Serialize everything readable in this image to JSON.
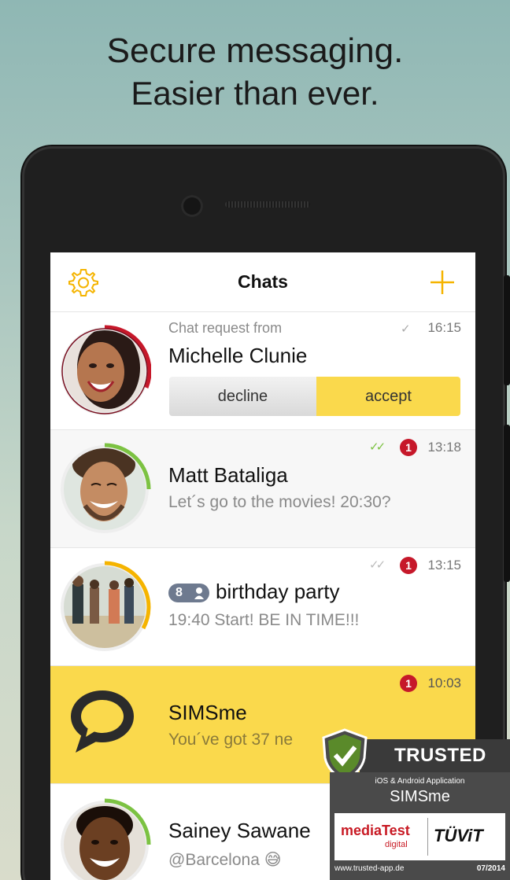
{
  "headline": {
    "line1": "Secure messaging.",
    "line2": "Easier than ever."
  },
  "app": {
    "title": "Chats",
    "accent_color": "#f5b400",
    "badge_color": "#c6182a"
  },
  "chats": [
    {
      "type": "request",
      "label": "Chat request from",
      "name": "Michelle Clunie",
      "time": "16:15",
      "status_icon": "single-check-icon",
      "decline_label": "decline",
      "accept_label": "accept",
      "ring_color": "#c6182a"
    },
    {
      "name": "Matt Bataliga",
      "message": "Let´s go to the movies! 20:30?",
      "time": "13:18",
      "unread": "1",
      "status_icon": "double-check-icon",
      "ring_color": "#7cc242"
    },
    {
      "name": "birthday party",
      "members": "8",
      "message": "19:40 Start! BE IN TIME!!!",
      "time": "13:15",
      "unread": "1",
      "status_icon": "double-check-icon",
      "ring_color": "#f5b400"
    },
    {
      "name": "SIMSme",
      "message": "You´ve got 37 ne",
      "time": "10:03",
      "unread": "1",
      "highlight_color": "#fad94c"
    },
    {
      "name": "Sainey Sawane",
      "message": "@Barcelona",
      "emoji": "😅",
      "ring_color": "#7cc242"
    }
  ],
  "seal": {
    "title": "TRUSTED APP",
    "platform": "iOS & Android Application",
    "app_name": "SIMSme",
    "logo1": "mediaTest",
    "logo1_sub": "digital",
    "logo2": "TÜViT",
    "url": "www.trusted-app.de",
    "date": "07/2014"
  }
}
